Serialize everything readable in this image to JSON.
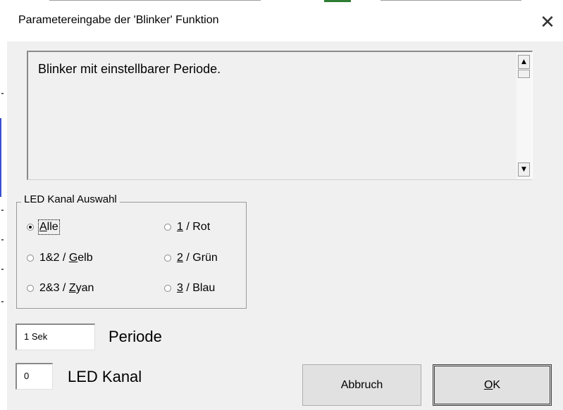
{
  "window": {
    "title": "Parametereingabe der 'Blinker' Funktion",
    "close_glyph": "✕"
  },
  "description": {
    "text": "Blinker mit einstellbarer Periode.",
    "scroll_up_glyph": "▲",
    "scroll_down_glyph": "▼"
  },
  "led_group": {
    "legend": "LED Kanal Auswahl",
    "options": [
      {
        "pre": "",
        "key": "A",
        "post": "lle",
        "checked": true
      },
      {
        "pre": "",
        "key": "1",
        "post": " / Rot",
        "checked": false
      },
      {
        "pre": "1&2 / ",
        "key": "G",
        "post": "elb",
        "checked": false
      },
      {
        "pre": "",
        "key": "2",
        "post": " / Grün",
        "checked": false
      },
      {
        "pre": "2&3 / ",
        "key": "Z",
        "post": "yan",
        "checked": false
      },
      {
        "pre": "",
        "key": "3",
        "post": " / Blau",
        "checked": false
      }
    ]
  },
  "periode": {
    "value": "1 Sek",
    "label": "Periode"
  },
  "led_kanal": {
    "value": "0",
    "label": "LED Kanal"
  },
  "buttons": {
    "cancel": "Abbruch",
    "ok_key": "O",
    "ok_rest": "K"
  },
  "background_colors": [
    "#2e7d32",
    "#9e9e9e",
    "#3a4fd1"
  ]
}
